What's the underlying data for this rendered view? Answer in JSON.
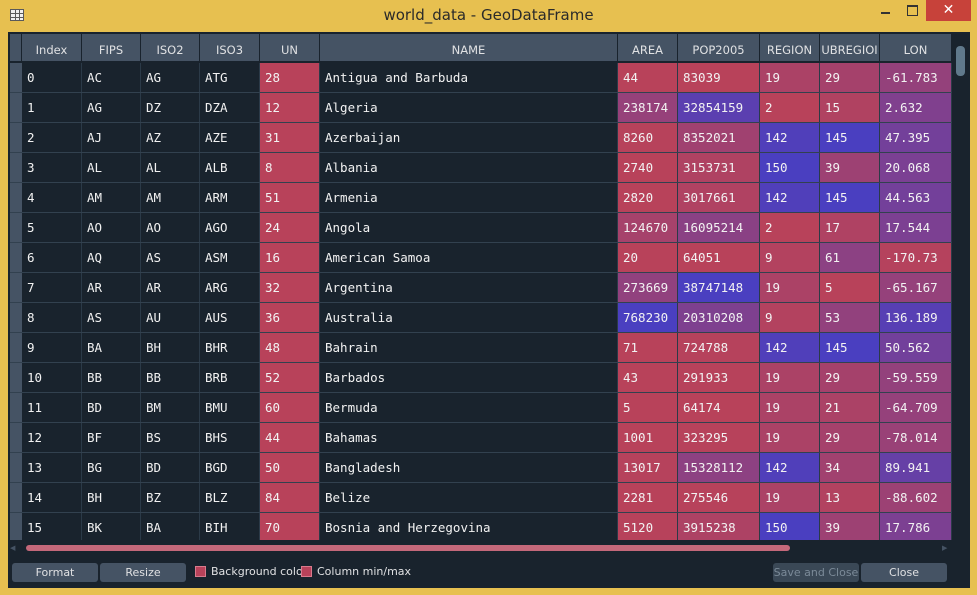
{
  "window": {
    "title": "world_data - GeoDataFrame"
  },
  "columns": [
    {
      "key": "index",
      "label": "Index"
    },
    {
      "key": "fips",
      "label": "FIPS"
    },
    {
      "key": "iso2",
      "label": "ISO2"
    },
    {
      "key": "iso3",
      "label": "ISO3"
    },
    {
      "key": "un",
      "label": "UN"
    },
    {
      "key": "name",
      "label": "NAME"
    },
    {
      "key": "area",
      "label": "AREA"
    },
    {
      "key": "pop2005",
      "label": "POP2005"
    },
    {
      "key": "region",
      "label": "REGION"
    },
    {
      "key": "subregion",
      "label": "UBREGIOI"
    },
    {
      "key": "lon",
      "label": "LON"
    }
  ],
  "rows": [
    {
      "index": "0",
      "fips": "AC",
      "iso2": "AG",
      "iso3": "ATG",
      "un": "28",
      "name": "Antigua and Barbuda",
      "area": "44",
      "pop2005": "83039",
      "region": "19",
      "subregion": "29",
      "lon": "-61.783"
    },
    {
      "index": "1",
      "fips": "AG",
      "iso2": "DZ",
      "iso3": "DZA",
      "un": "12",
      "name": "Algeria",
      "area": "238174",
      "pop2005": "32854159",
      "region": "2",
      "subregion": "15",
      "lon": "2.632"
    },
    {
      "index": "2",
      "fips": "AJ",
      "iso2": "AZ",
      "iso3": "AZE",
      "un": "31",
      "name": "Azerbaijan",
      "area": "8260",
      "pop2005": "8352021",
      "region": "142",
      "subregion": "145",
      "lon": "47.395"
    },
    {
      "index": "3",
      "fips": "AL",
      "iso2": "AL",
      "iso3": "ALB",
      "un": "8",
      "name": "Albania",
      "area": "2740",
      "pop2005": "3153731",
      "region": "150",
      "subregion": "39",
      "lon": "20.068"
    },
    {
      "index": "4",
      "fips": "AM",
      "iso2": "AM",
      "iso3": "ARM",
      "un": "51",
      "name": "Armenia",
      "area": "2820",
      "pop2005": "3017661",
      "region": "142",
      "subregion": "145",
      "lon": "44.563"
    },
    {
      "index": "5",
      "fips": "AO",
      "iso2": "AO",
      "iso3": "AGO",
      "un": "24",
      "name": "Angola",
      "area": "124670",
      "pop2005": "16095214",
      "region": "2",
      "subregion": "17",
      "lon": "17.544"
    },
    {
      "index": "6",
      "fips": "AQ",
      "iso2": "AS",
      "iso3": "ASM",
      "un": "16",
      "name": "American Samoa",
      "area": "20",
      "pop2005": "64051",
      "region": "9",
      "subregion": "61",
      "lon": "-170.73"
    },
    {
      "index": "7",
      "fips": "AR",
      "iso2": "AR",
      "iso3": "ARG",
      "un": "32",
      "name": "Argentina",
      "area": "273669",
      "pop2005": "38747148",
      "region": "19",
      "subregion": "5",
      "lon": "-65.167"
    },
    {
      "index": "8",
      "fips": "AS",
      "iso2": "AU",
      "iso3": "AUS",
      "un": "36",
      "name": "Australia",
      "area": "768230",
      "pop2005": "20310208",
      "region": "9",
      "subregion": "53",
      "lon": "136.189"
    },
    {
      "index": "9",
      "fips": "BA",
      "iso2": "BH",
      "iso3": "BHR",
      "un": "48",
      "name": "Bahrain",
      "area": "71",
      "pop2005": "724788",
      "region": "142",
      "subregion": "145",
      "lon": "50.562"
    },
    {
      "index": "10",
      "fips": "BB",
      "iso2": "BB",
      "iso3": "BRB",
      "un": "52",
      "name": "Barbados",
      "area": "43",
      "pop2005": "291933",
      "region": "19",
      "subregion": "29",
      "lon": "-59.559"
    },
    {
      "index": "11",
      "fips": "BD",
      "iso2": "BM",
      "iso3": "BMU",
      "un": "60",
      "name": "Bermuda",
      "area": "5",
      "pop2005": "64174",
      "region": "19",
      "subregion": "21",
      "lon": "-64.709"
    },
    {
      "index": "12",
      "fips": "BF",
      "iso2": "BS",
      "iso3": "BHS",
      "un": "44",
      "name": "Bahamas",
      "area": "1001",
      "pop2005": "323295",
      "region": "19",
      "subregion": "29",
      "lon": "-78.014"
    },
    {
      "index": "13",
      "fips": "BG",
      "iso2": "BD",
      "iso3": "BGD",
      "un": "50",
      "name": "Bangladesh",
      "area": "13017",
      "pop2005": "15328112",
      "region": "142",
      "subregion": "34",
      "lon": "89.941"
    },
    {
      "index": "14",
      "fips": "BH",
      "iso2": "BZ",
      "iso3": "BLZ",
      "un": "84",
      "name": "Belize",
      "area": "2281",
      "pop2005": "275546",
      "region": "19",
      "subregion": "13",
      "lon": "-88.602"
    },
    {
      "index": "15",
      "fips": "BK",
      "iso2": "BA",
      "iso3": "BIH",
      "un": "70",
      "name": "Bosnia and Herzegovina",
      "area": "5120",
      "pop2005": "3915238",
      "region": "150",
      "subregion": "39",
      "lon": "17.786"
    }
  ],
  "bottom": {
    "format_label": "Format",
    "resize_label": "Resize",
    "bgcolor_label": "Background color",
    "minmax_label": "Column min/max",
    "save_close_label": "Save and Close",
    "close_label": "Close"
  },
  "colors": {
    "background_dark": "#19232d",
    "header_bg": "#455364",
    "cell_red": "#b8425a",
    "cell_blue": "#4a3fc0",
    "titlebar": "#e7c050"
  }
}
